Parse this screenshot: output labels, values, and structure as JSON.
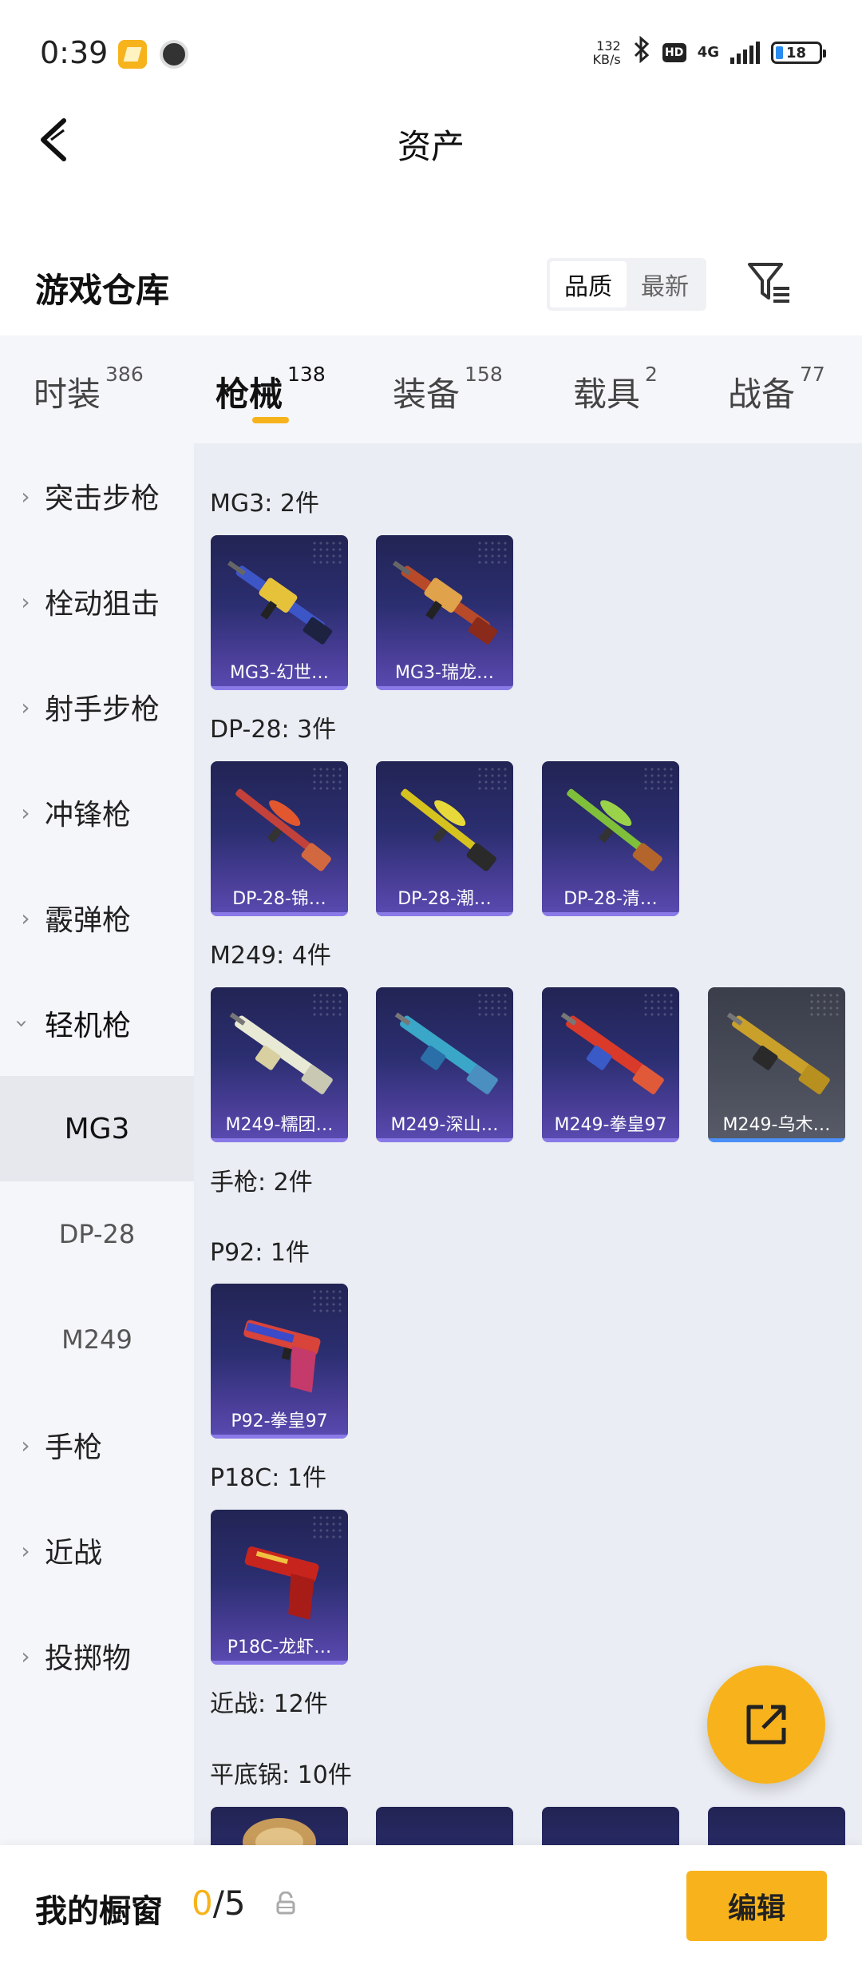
{
  "status_bar": {
    "time": "0:39",
    "net_speed_value": "132",
    "net_speed_unit": "KB/s",
    "hd_label": "HD",
    "network_type": "4G",
    "battery_level": "18",
    "icons": [
      "notes-app-icon",
      "clock-app-icon",
      "bluetooth-icon",
      "hd-icon",
      "signal-icon",
      "battery-icon"
    ]
  },
  "header": {
    "title": "资产",
    "back_icon": "chevron-left-icon"
  },
  "section": {
    "title": "游戏仓库",
    "sort_options": [
      "品质",
      "最新"
    ],
    "sort_selected": "品质",
    "filter_icon": "filter-icon"
  },
  "category_tabs": [
    {
      "label": "时装",
      "count": "386"
    },
    {
      "label": "枪械",
      "count": "138",
      "active": true
    },
    {
      "label": "装备",
      "count": "158"
    },
    {
      "label": "载具",
      "count": "2"
    },
    {
      "label": "战备",
      "count": "77"
    }
  ],
  "sidebar": {
    "items": [
      {
        "label": "突击步枪"
      },
      {
        "label": "栓动狙击"
      },
      {
        "label": "射手步枪"
      },
      {
        "label": "冲锋枪"
      },
      {
        "label": "霰弹枪"
      },
      {
        "label": "轻机枪",
        "expanded": true
      },
      {
        "label": "手枪"
      },
      {
        "label": "近战"
      },
      {
        "label": "投掷物"
      }
    ],
    "sub_items": [
      {
        "label": "MG3",
        "active": true
      },
      {
        "label": "DP-28"
      },
      {
        "label": "M249"
      }
    ]
  },
  "content": {
    "groups": {
      "mg3": "MG3: 2件",
      "dp28": "DP-28: 3件",
      "m249": "M249: 4件",
      "pistol": "手枪: 2件",
      "p92": "P92: 1件",
      "p18c": "P18C: 1件",
      "melee": "近战: 12件",
      "pan": "平底锅: 10件"
    },
    "cards": {
      "mg3_1": "MG3-幻世…",
      "mg3_2": "MG3-瑞龙…",
      "dp28_1": "DP-28-锦…",
      "dp28_2": "DP-28-潮…",
      "dp28_3": "DP-28-清…",
      "m249_1": "M249-糯团…",
      "m249_2": "M249-深山…",
      "m249_3": "M249-拳皇97",
      "m249_4": "M249-乌木…",
      "p92_1": "P92-拳皇97",
      "p18c_1": "P18C-龙虾…"
    }
  },
  "fab_icon": "share-external-icon",
  "bottom_bar": {
    "window_label": "我的橱窗",
    "window_current": "0",
    "window_total": "/5",
    "lock_icon": "lock-icon",
    "edit_label": "编辑"
  },
  "colors": {
    "accent": "#f8b31c",
    "card_purple": "#2b2e70",
    "content_bg": "#eaedf3",
    "sidebar_bg": "#f5f6fa"
  }
}
